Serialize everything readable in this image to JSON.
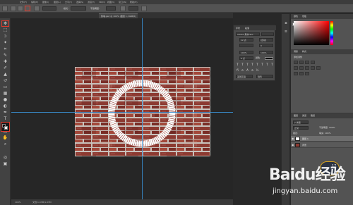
{
  "menubar": {
    "items": [
      "文件(F)",
      "编辑(E)",
      "图像(I)",
      "图层(L)",
      "文字(Y)",
      "选择(S)",
      "滤镜(T)",
      "3D(D)",
      "视图(V)",
      "窗口(W)",
      "帮助(H)"
    ]
  },
  "options": {
    "mode_label": "模式:",
    "mode_value": "正常",
    "opacity_label": "不透明度:",
    "opacity_value": "100%"
  },
  "tabs": [
    {
      "label": "砖墙.psd @ 100% (图层 1, RGB/8)"
    }
  ],
  "character_panel": {
    "tab1": "字符",
    "tab2": "段落",
    "font_family": "Adobe 黑体 Std",
    "size": "12 点",
    "leading": "(自动)",
    "tracking": "0",
    "scale_v": "100%",
    "scale_h": "100%",
    "baseline": "0 点",
    "color_label": "颜色:",
    "lang": "美国英语",
    "aa": "锐利"
  },
  "right_panels": {
    "color_tab": "颜色",
    "swatch_tab": "色板",
    "adjust_tab": "调整",
    "style_tab": "样式",
    "adjust_hint": "添加调整",
    "layers_tab": "图层",
    "channels_tab": "通道",
    "paths_tab": "路径",
    "kind_label": "ρ 类型",
    "blend": "正常",
    "opacity": "不透明度: 100%",
    "lock": "锁定:",
    "fill": "填充: 100%"
  },
  "layers": [
    {
      "name": "图层 1",
      "active": true
    },
    {
      "name": "背景",
      "active": false
    }
  ],
  "status": {
    "zoom": "100%",
    "doc": "文档:1.03M/1.03M"
  },
  "watermark": {
    "main": "Baidu经验",
    "sub": "jingyan.baidu.com"
  },
  "avatar_badge": "17",
  "colors": {
    "accent_red": "#e03a2c",
    "guide_blue": "#3a8fd0",
    "avatar_ring": "#d9a21b"
  }
}
